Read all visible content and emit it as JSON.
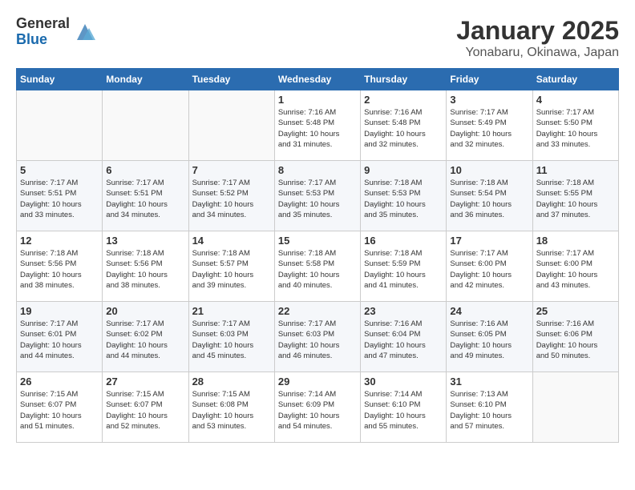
{
  "logo": {
    "general": "General",
    "blue": "Blue"
  },
  "title": "January 2025",
  "subtitle": "Yonabaru, Okinawa, Japan",
  "days_of_week": [
    "Sunday",
    "Monday",
    "Tuesday",
    "Wednesday",
    "Thursday",
    "Friday",
    "Saturday"
  ],
  "weeks": [
    [
      {
        "day": "",
        "info": ""
      },
      {
        "day": "",
        "info": ""
      },
      {
        "day": "",
        "info": ""
      },
      {
        "day": "1",
        "info": "Sunrise: 7:16 AM\nSunset: 5:48 PM\nDaylight: 10 hours\nand 31 minutes."
      },
      {
        "day": "2",
        "info": "Sunrise: 7:16 AM\nSunset: 5:48 PM\nDaylight: 10 hours\nand 32 minutes."
      },
      {
        "day": "3",
        "info": "Sunrise: 7:17 AM\nSunset: 5:49 PM\nDaylight: 10 hours\nand 32 minutes."
      },
      {
        "day": "4",
        "info": "Sunrise: 7:17 AM\nSunset: 5:50 PM\nDaylight: 10 hours\nand 33 minutes."
      }
    ],
    [
      {
        "day": "5",
        "info": "Sunrise: 7:17 AM\nSunset: 5:51 PM\nDaylight: 10 hours\nand 33 minutes."
      },
      {
        "day": "6",
        "info": "Sunrise: 7:17 AM\nSunset: 5:51 PM\nDaylight: 10 hours\nand 34 minutes."
      },
      {
        "day": "7",
        "info": "Sunrise: 7:17 AM\nSunset: 5:52 PM\nDaylight: 10 hours\nand 34 minutes."
      },
      {
        "day": "8",
        "info": "Sunrise: 7:17 AM\nSunset: 5:53 PM\nDaylight: 10 hours\nand 35 minutes."
      },
      {
        "day": "9",
        "info": "Sunrise: 7:18 AM\nSunset: 5:53 PM\nDaylight: 10 hours\nand 35 minutes."
      },
      {
        "day": "10",
        "info": "Sunrise: 7:18 AM\nSunset: 5:54 PM\nDaylight: 10 hours\nand 36 minutes."
      },
      {
        "day": "11",
        "info": "Sunrise: 7:18 AM\nSunset: 5:55 PM\nDaylight: 10 hours\nand 37 minutes."
      }
    ],
    [
      {
        "day": "12",
        "info": "Sunrise: 7:18 AM\nSunset: 5:56 PM\nDaylight: 10 hours\nand 38 minutes."
      },
      {
        "day": "13",
        "info": "Sunrise: 7:18 AM\nSunset: 5:56 PM\nDaylight: 10 hours\nand 38 minutes."
      },
      {
        "day": "14",
        "info": "Sunrise: 7:18 AM\nSunset: 5:57 PM\nDaylight: 10 hours\nand 39 minutes."
      },
      {
        "day": "15",
        "info": "Sunrise: 7:18 AM\nSunset: 5:58 PM\nDaylight: 10 hours\nand 40 minutes."
      },
      {
        "day": "16",
        "info": "Sunrise: 7:18 AM\nSunset: 5:59 PM\nDaylight: 10 hours\nand 41 minutes."
      },
      {
        "day": "17",
        "info": "Sunrise: 7:17 AM\nSunset: 6:00 PM\nDaylight: 10 hours\nand 42 minutes."
      },
      {
        "day": "18",
        "info": "Sunrise: 7:17 AM\nSunset: 6:00 PM\nDaylight: 10 hours\nand 43 minutes."
      }
    ],
    [
      {
        "day": "19",
        "info": "Sunrise: 7:17 AM\nSunset: 6:01 PM\nDaylight: 10 hours\nand 44 minutes."
      },
      {
        "day": "20",
        "info": "Sunrise: 7:17 AM\nSunset: 6:02 PM\nDaylight: 10 hours\nand 44 minutes."
      },
      {
        "day": "21",
        "info": "Sunrise: 7:17 AM\nSunset: 6:03 PM\nDaylight: 10 hours\nand 45 minutes."
      },
      {
        "day": "22",
        "info": "Sunrise: 7:17 AM\nSunset: 6:03 PM\nDaylight: 10 hours\nand 46 minutes."
      },
      {
        "day": "23",
        "info": "Sunrise: 7:16 AM\nSunset: 6:04 PM\nDaylight: 10 hours\nand 47 minutes."
      },
      {
        "day": "24",
        "info": "Sunrise: 7:16 AM\nSunset: 6:05 PM\nDaylight: 10 hours\nand 49 minutes."
      },
      {
        "day": "25",
        "info": "Sunrise: 7:16 AM\nSunset: 6:06 PM\nDaylight: 10 hours\nand 50 minutes."
      }
    ],
    [
      {
        "day": "26",
        "info": "Sunrise: 7:15 AM\nSunset: 6:07 PM\nDaylight: 10 hours\nand 51 minutes."
      },
      {
        "day": "27",
        "info": "Sunrise: 7:15 AM\nSunset: 6:07 PM\nDaylight: 10 hours\nand 52 minutes."
      },
      {
        "day": "28",
        "info": "Sunrise: 7:15 AM\nSunset: 6:08 PM\nDaylight: 10 hours\nand 53 minutes."
      },
      {
        "day": "29",
        "info": "Sunrise: 7:14 AM\nSunset: 6:09 PM\nDaylight: 10 hours\nand 54 minutes."
      },
      {
        "day": "30",
        "info": "Sunrise: 7:14 AM\nSunset: 6:10 PM\nDaylight: 10 hours\nand 55 minutes."
      },
      {
        "day": "31",
        "info": "Sunrise: 7:13 AM\nSunset: 6:10 PM\nDaylight: 10 hours\nand 57 minutes."
      },
      {
        "day": "",
        "info": ""
      }
    ]
  ]
}
